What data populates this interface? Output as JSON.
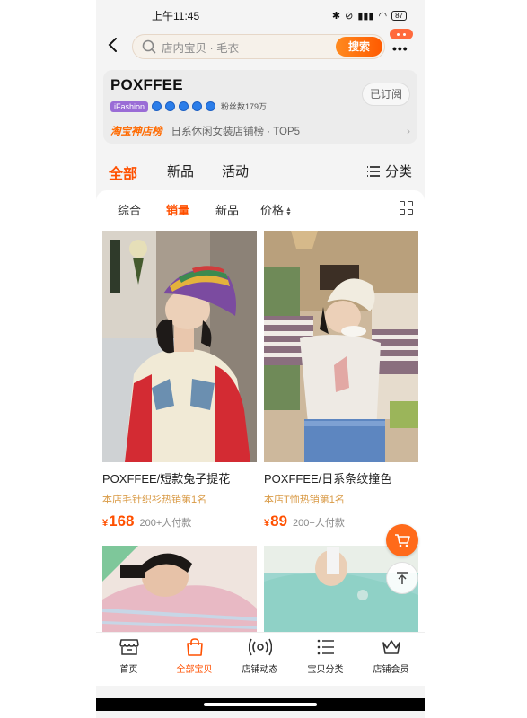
{
  "status_bar": {
    "time": "上午11:45",
    "battery": "87"
  },
  "search": {
    "placeholder": "店内宝贝 · 毛衣",
    "button": "搜索"
  },
  "shop": {
    "name": "POXFFEE",
    "tag": "iFashion",
    "fans": "粉丝数179万",
    "subscribe_label": "已订阅",
    "rank_title": "淘宝神店榜",
    "rank_text": "日系休闲女装店铺榜 · TOP5"
  },
  "category_tabs": [
    "全部",
    "新品",
    "活动"
  ],
  "classify_label": "分类",
  "sort_tabs": [
    "综合",
    "销量",
    "新品",
    "价格"
  ],
  "products": [
    {
      "title": "POXFFEE/短款兔子提花",
      "rank": "本店毛针织衫热销第1名",
      "currency": "¥",
      "price": "168",
      "sold": "200+人付款"
    },
    {
      "title": "POXFFEE/日系条纹撞色",
      "rank": "本店T恤热销第1名",
      "currency": "¥",
      "price": "89",
      "sold": "200+人付款"
    }
  ],
  "bottom_nav": [
    {
      "label": "首页",
      "icon": "storefront-icon"
    },
    {
      "label": "全部宝贝",
      "icon": "shopping-bag-icon"
    },
    {
      "label": "店铺动态",
      "icon": "broadcast-icon"
    },
    {
      "label": "宝贝分类",
      "icon": "list-icon"
    },
    {
      "label": "店铺会员",
      "icon": "crown-icon"
    }
  ],
  "colors": {
    "accent": "#ff5000",
    "rank_gold": "#d99a45",
    "search_button": "#ff6a00"
  }
}
